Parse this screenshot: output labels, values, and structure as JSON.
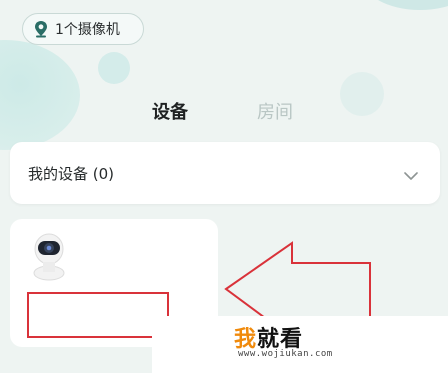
{
  "header": {
    "camera_pill_label": "1个摄像机",
    "camera_pill_icon": "location-pin-icon"
  },
  "tabs": [
    {
      "label": "设备",
      "active": true
    },
    {
      "label": "房间",
      "active": false
    }
  ],
  "device_dropdown": {
    "label": "我的设备 (0)",
    "icon": "chevron-down-icon"
  },
  "device_card": {
    "icon": "security-camera-icon",
    "name": ""
  },
  "annotation": {
    "arrow_color": "#d9323a",
    "box_color": "#d9323a"
  },
  "watermark": {
    "title_accent": "我",
    "title_rest": "就看",
    "url": "www.wojiukan.com"
  }
}
